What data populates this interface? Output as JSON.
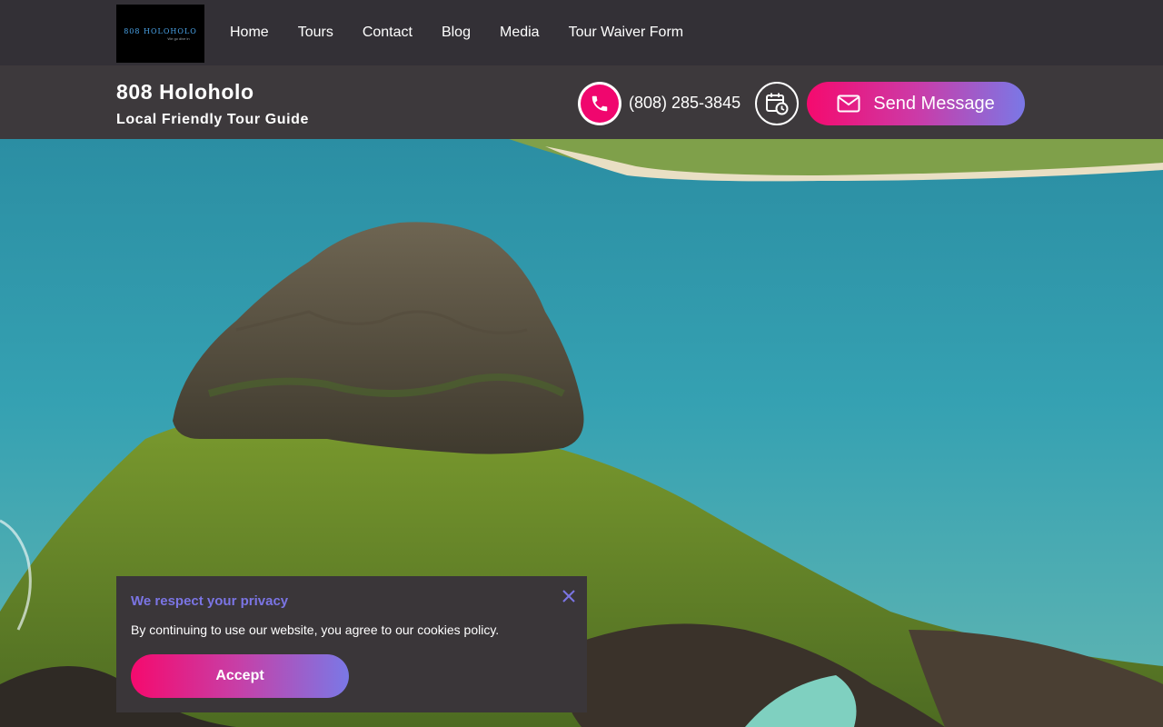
{
  "logo": {
    "text": "808 HOLOHOLO",
    "tagline": "We go dive in"
  },
  "nav": [
    {
      "label": "Home"
    },
    {
      "label": "Tours"
    },
    {
      "label": "Contact"
    },
    {
      "label": "Blog"
    },
    {
      "label": "Media"
    },
    {
      "label": "Tour Waiver Form"
    }
  ],
  "header": {
    "title": "808 Holoholo",
    "subtitle": "Local Friendly Tour Guide",
    "phone": "(808) 285-3845",
    "send_label": "Send Message"
  },
  "cookie": {
    "title": "We respect your privacy",
    "text": "By continuing to use our website, you agree to our cookies policy.",
    "accept_label": "Accept"
  },
  "colors": {
    "accent_pink": "#f50a6e",
    "accent_purple": "#7a78e6",
    "nav_bg": "#333036",
    "subheader_bg": "#3d393c"
  },
  "icons": [
    "phone-icon",
    "calendar-clock-icon",
    "mail-icon",
    "close-icon"
  ]
}
